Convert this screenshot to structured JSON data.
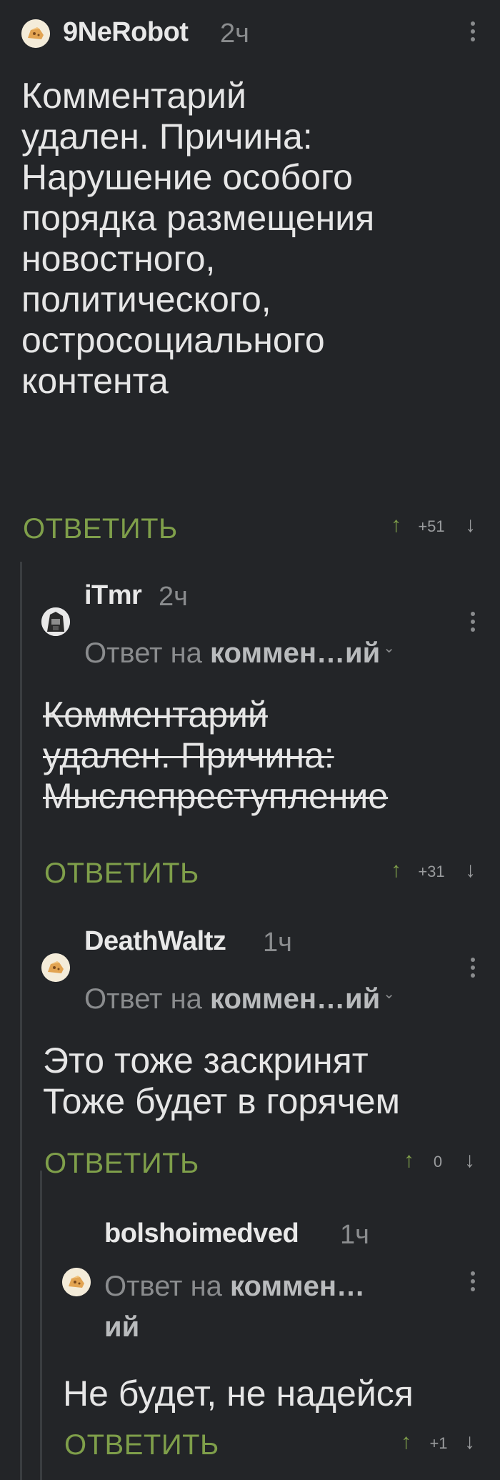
{
  "comments": [
    {
      "username": "9NeRobot",
      "time": "2ч",
      "text": "Комментарий\nудален. Причина:\nНарушение особого\nпорядка размещения\nновостного,\nполитического,\nостросоциального\nконтента",
      "reply_label": "ОТВЕТИТЬ",
      "score": "+51"
    },
    {
      "username": "iTmr",
      "time": "2ч",
      "reply_prefix": "Ответ на",
      "reply_target": "коммен…ий",
      "text": "Комментарий\nудален. Причина:\nМыслепреступление",
      "reply_label": "ОТВЕТИТЬ",
      "score": "+31"
    },
    {
      "username": "DeathWaltz",
      "time": "1ч",
      "reply_prefix": "Ответ на",
      "reply_target": "коммен…ий",
      "text": "Это тоже заскринят\nТоже будет в горячем",
      "reply_label": "ОТВЕТИТЬ",
      "score": "0"
    },
    {
      "username": "bolshoimedved",
      "time": "1ч",
      "reply_prefix": "Ответ на",
      "reply_target": "коммен…",
      "reply_target_cont": "ий",
      "text": "Не будет, не надейся",
      "reply_label": "ОТВЕТИТЬ",
      "score": "+1"
    }
  ],
  "icons": {
    "upvote": "arrow-up-icon",
    "downvote": "arrow-down-icon",
    "more": "more-vertical-icon",
    "expand": "chevron-down-icon"
  },
  "colors": {
    "background": "#232528",
    "accent_green": "#7f9f4a",
    "muted": "#8a8c8e",
    "text": "#e6e6e6"
  }
}
